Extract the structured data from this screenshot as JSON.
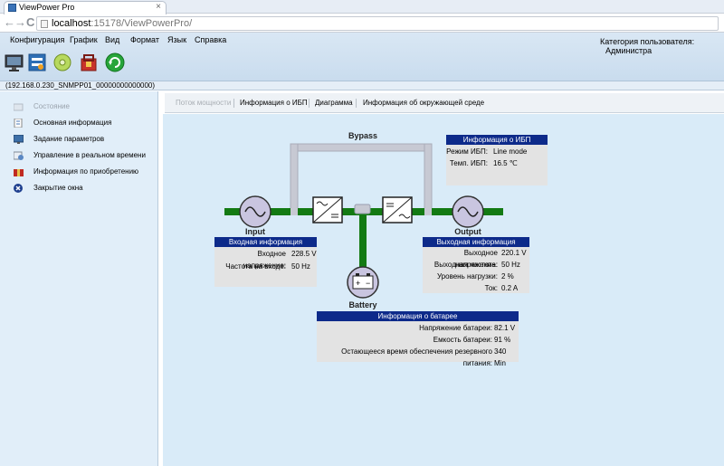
{
  "browser": {
    "tab_title": "ViewPower Pro",
    "tab_close": "×",
    "url_host": "localhost",
    "url_rest": ":15178/ViewPowerPro/",
    "back": "←",
    "forward": "→",
    "reload": "C"
  },
  "menu": {
    "items": [
      "Конфигурация",
      "График",
      "Вид",
      "Формат",
      "Язык",
      "Справка"
    ],
    "user_label": "Категория пользователя:",
    "user_value": "Администра"
  },
  "toolbar": {
    "icons": [
      "monitor-icon",
      "settings-tools-icon",
      "cd-icon",
      "shopping-bag-icon",
      "refresh-icon"
    ]
  },
  "device_id": "(192.168.0.230_SNMPP01_00000000000000)",
  "sidebar": {
    "items": [
      {
        "label": "Состояние",
        "icon": "status-icon",
        "disabled": true
      },
      {
        "label": "Основная информация",
        "icon": "info-sheet-icon",
        "disabled": false
      },
      {
        "label": "Задание параметров",
        "icon": "monitor-icon",
        "disabled": false
      },
      {
        "label": "Управление в реальном времени",
        "icon": "control-icon",
        "disabled": false
      },
      {
        "label": "Информация по приобретению",
        "icon": "gift-icon",
        "disabled": false
      },
      {
        "label": "Закрытие окна",
        "icon": "close-window-icon",
        "disabled": false
      }
    ]
  },
  "tabs": [
    {
      "label": "Поток мощности",
      "disabled": true
    },
    {
      "label": "Информация о ИБП",
      "disabled": false
    },
    {
      "label": "Диаграмма",
      "disabled": false
    },
    {
      "label": "Информация об окружающей среде",
      "disabled": false
    }
  ],
  "diagram": {
    "bypass": "Bypass",
    "input": "Input",
    "output": "Output",
    "battery": "Battery",
    "colors": {
      "active": "#137a13",
      "inactive": "#c7c9d3",
      "header": "#0d2a8a"
    }
  },
  "ups_info": {
    "title": "Информация о ИБП",
    "rows": [
      {
        "label": "Режим ИБП:",
        "value": "Line mode"
      },
      {
        "label": "Темп. ИБП:",
        "value": "16.5  ℃"
      }
    ]
  },
  "input_info": {
    "title": "Входная информация",
    "rows": [
      {
        "label": "Входное напряжение:",
        "value": "228.5 V"
      },
      {
        "label": "Частота на входе:",
        "value": "50 Hz"
      }
    ]
  },
  "output_info": {
    "title": "Выходная информация",
    "rows": [
      {
        "label": "Выходное напряжение:",
        "value": "220.1 V"
      },
      {
        "label": "Выходная частота:",
        "value": "50 Hz"
      },
      {
        "label": "Уровень нагрузки:",
        "value": "2 %"
      },
      {
        "label": "Ток:",
        "value": "0.2 A"
      }
    ]
  },
  "battery_info": {
    "title": "Информация о батарее",
    "rows": [
      {
        "label": "Напряжение батареи:",
        "value": "82.1 V"
      },
      {
        "label": "Емкость батареи:",
        "value": "91 %"
      },
      {
        "label": "Остающееся время обеспечения резервного питания:",
        "value": "340 Min"
      }
    ]
  }
}
